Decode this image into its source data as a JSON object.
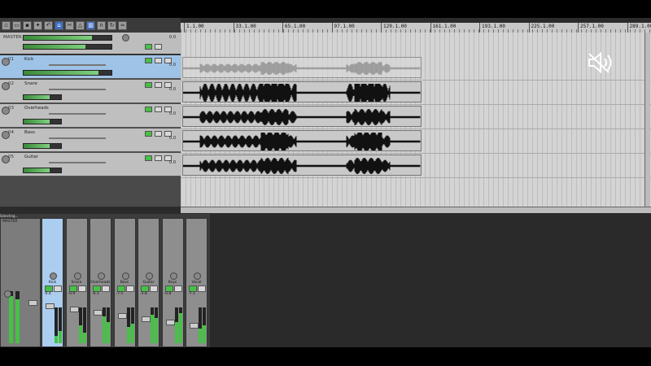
{
  "toolbar": {
    "icons": [
      "new-icon",
      "open-icon",
      "save-icon",
      "settings-icon",
      "undo-icon",
      "home-icon",
      "cut-icon",
      "metronome-icon",
      "grid-icon",
      "snap-icon",
      "loop-icon",
      "envelope-icon"
    ]
  },
  "ruler": {
    "labels": [
      "1.1.00",
      "33.1.00",
      "65.1.00",
      "97.1.00",
      "129.1.00",
      "161.1.00",
      "193.1.00",
      "225.1.00",
      "257.1.00",
      "289.1.00"
    ]
  },
  "master": {
    "label": "MASTER",
    "volume": "0.0"
  },
  "tracks": [
    {
      "num": "01",
      "name": "Kick",
      "volume": "0.0",
      "selected": true
    },
    {
      "num": "02",
      "name": "Snare",
      "volume": "0.0",
      "selected": false
    },
    {
      "num": "03",
      "name": "Overheads",
      "volume": "0.0",
      "selected": false
    },
    {
      "num": "04",
      "name": "Bass",
      "volume": "0.0",
      "selected": false
    },
    {
      "num": "05",
      "name": "Guitar",
      "volume": "0.0",
      "selected": false
    }
  ],
  "mixer": {
    "status": "Selecting...",
    "strips": [
      {
        "label": "Kick",
        "db": "-0.4",
        "selected": true
      },
      {
        "label": "Snare",
        "db": "-0.9",
        "selected": false
      },
      {
        "label": "Overheads",
        "db": "-6.1",
        "selected": false
      },
      {
        "label": "Bass",
        "db": "-7.5",
        "selected": false
      },
      {
        "label": "Guitar",
        "db": "-3.8",
        "selected": false
      },
      {
        "label": "Keys",
        "db": "-0.8",
        "selected": false
      },
      {
        "label": "Vocal",
        "db": "-7.1",
        "selected": false
      }
    ],
    "meter_levels": [
      0.2,
      0.35,
      0.5,
      0.3,
      0.75,
      0.6,
      0.45,
      0.55,
      0.8,
      0.7,
      0.6,
      0.85,
      0.4,
      0.5
    ],
    "master_meter_levels": [
      0.9,
      0.85
    ]
  },
  "colors": {
    "accent": "#3d6fc4",
    "selected": "#9fc3e6",
    "meter": "#45c245"
  }
}
